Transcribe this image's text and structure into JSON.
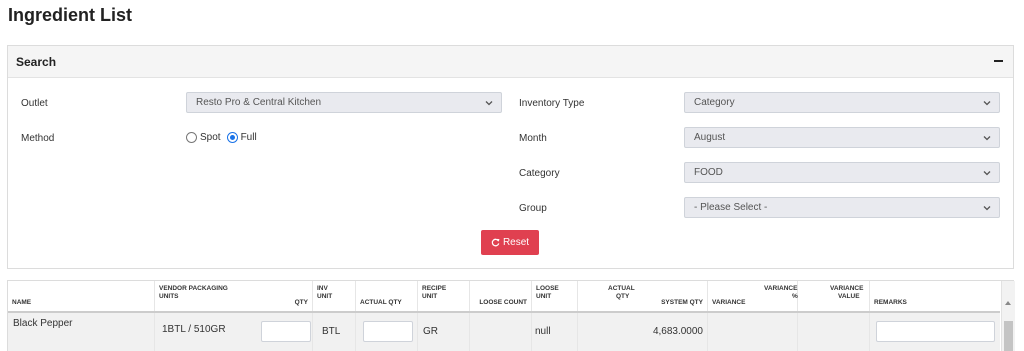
{
  "page": {
    "title": "Ingredient List"
  },
  "search": {
    "title": "Search",
    "outlet": {
      "label": "Outlet",
      "value": "Resto Pro & Central Kitchen"
    },
    "method": {
      "label": "Method",
      "options": [
        "Spot",
        "Full"
      ],
      "selected": "Full"
    },
    "inventory_type": {
      "label": "Inventory Type",
      "value": "Category"
    },
    "month": {
      "label": "Month",
      "value": "August"
    },
    "category": {
      "label": "Category",
      "value": "FOOD"
    },
    "group": {
      "label": "Group",
      "value": "- Please Select -"
    },
    "reset_label": "Reset"
  },
  "table": {
    "headers": {
      "name": "NAME",
      "vendor_packaging_units_line1": "VENDOR PACKAGING",
      "vendor_packaging_units_line2": "UNITS",
      "qty": "QTY",
      "inv_unit_line1": "INV",
      "inv_unit_line2": "UNIT",
      "actual_qty": "ACTUAL QTY",
      "recipe_unit_line1": "RECIPE",
      "recipe_unit_line2": "UNIT",
      "loose_count": "LOOSE COUNT",
      "loose_unit_line1": "LOOSE",
      "loose_unit_line2": "UNIT",
      "actual_qty2_line1": "ACTUAL",
      "actual_qty2_line2": "QTY",
      "system_qty": "SYSTEM QTY",
      "variance": "VARIANCE",
      "variance_pct_line1": "VARIANCE",
      "variance_pct_line2": "%",
      "variance_value_line1": "VARIANCE",
      "variance_value_line2": "VALUE",
      "remarks": "REMARKS"
    },
    "rows": [
      {
        "name": "Black Pepper",
        "vendor_packaging": "1BTL / 510GR",
        "inv_unit": "BTL",
        "recipe_unit": "GR",
        "loose_unit": "null",
        "system_qty": "4,683.0000"
      }
    ]
  },
  "colors": {
    "accent": "#1a73e8",
    "reset": "#e04050",
    "select_bg": "#e9eaef"
  }
}
